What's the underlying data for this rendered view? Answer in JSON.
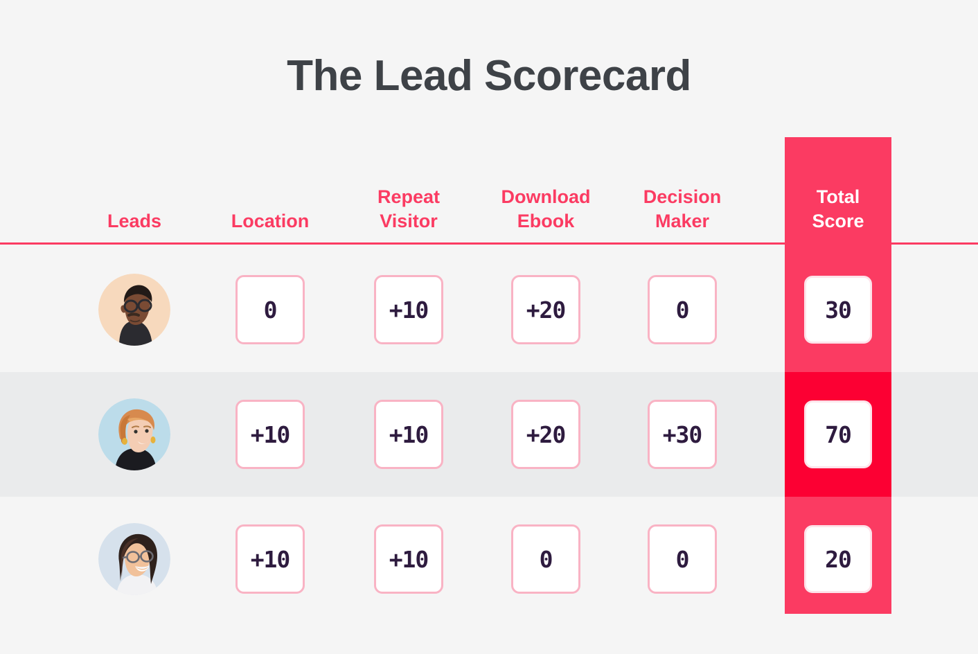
{
  "page": {
    "title": "The Lead Scorecard",
    "background_color": "#f5f5f5",
    "accent_color": "#fb3b62",
    "highlight_color": "#fc0033",
    "value_text_color": "#2e1b3f",
    "box_border_color": "#f9b3c4"
  },
  "table": {
    "columns": [
      {
        "key": "leads",
        "label": "Leads",
        "label_line1": "Leads",
        "label_line2": ""
      },
      {
        "key": "location",
        "label": "Location",
        "label_line1": "Location",
        "label_line2": ""
      },
      {
        "key": "repeat_visitor",
        "label": "Repeat Visitor",
        "label_line1": "Repeat",
        "label_line2": "Visitor"
      },
      {
        "key": "download_ebook",
        "label": "Download Ebook",
        "label_line1": "Download",
        "label_line2": "Ebook"
      },
      {
        "key": "decision_maker",
        "label": "Decision Maker",
        "label_line1": "Decision",
        "label_line2": "Maker"
      },
      {
        "key": "total_score",
        "label": "Total Score",
        "label_line1": "Total",
        "label_line2": "Score"
      }
    ],
    "rows": [
      {
        "avatar": "avatar-man-glasses-peach",
        "location": "0",
        "repeat_visitor": "+10",
        "download_ebook": "+20",
        "decision_maker": "0",
        "total_score": "30",
        "highlighted": false
      },
      {
        "avatar": "avatar-woman-short-hair-blue",
        "location": "+10",
        "repeat_visitor": "+10",
        "download_ebook": "+20",
        "decision_maker": "+30",
        "total_score": "70",
        "highlighted": true
      },
      {
        "avatar": "avatar-woman-glasses-lightblue",
        "location": "+10",
        "repeat_visitor": "+10",
        "download_ebook": "0",
        "decision_maker": "0",
        "total_score": "20",
        "highlighted": false
      }
    ]
  }
}
